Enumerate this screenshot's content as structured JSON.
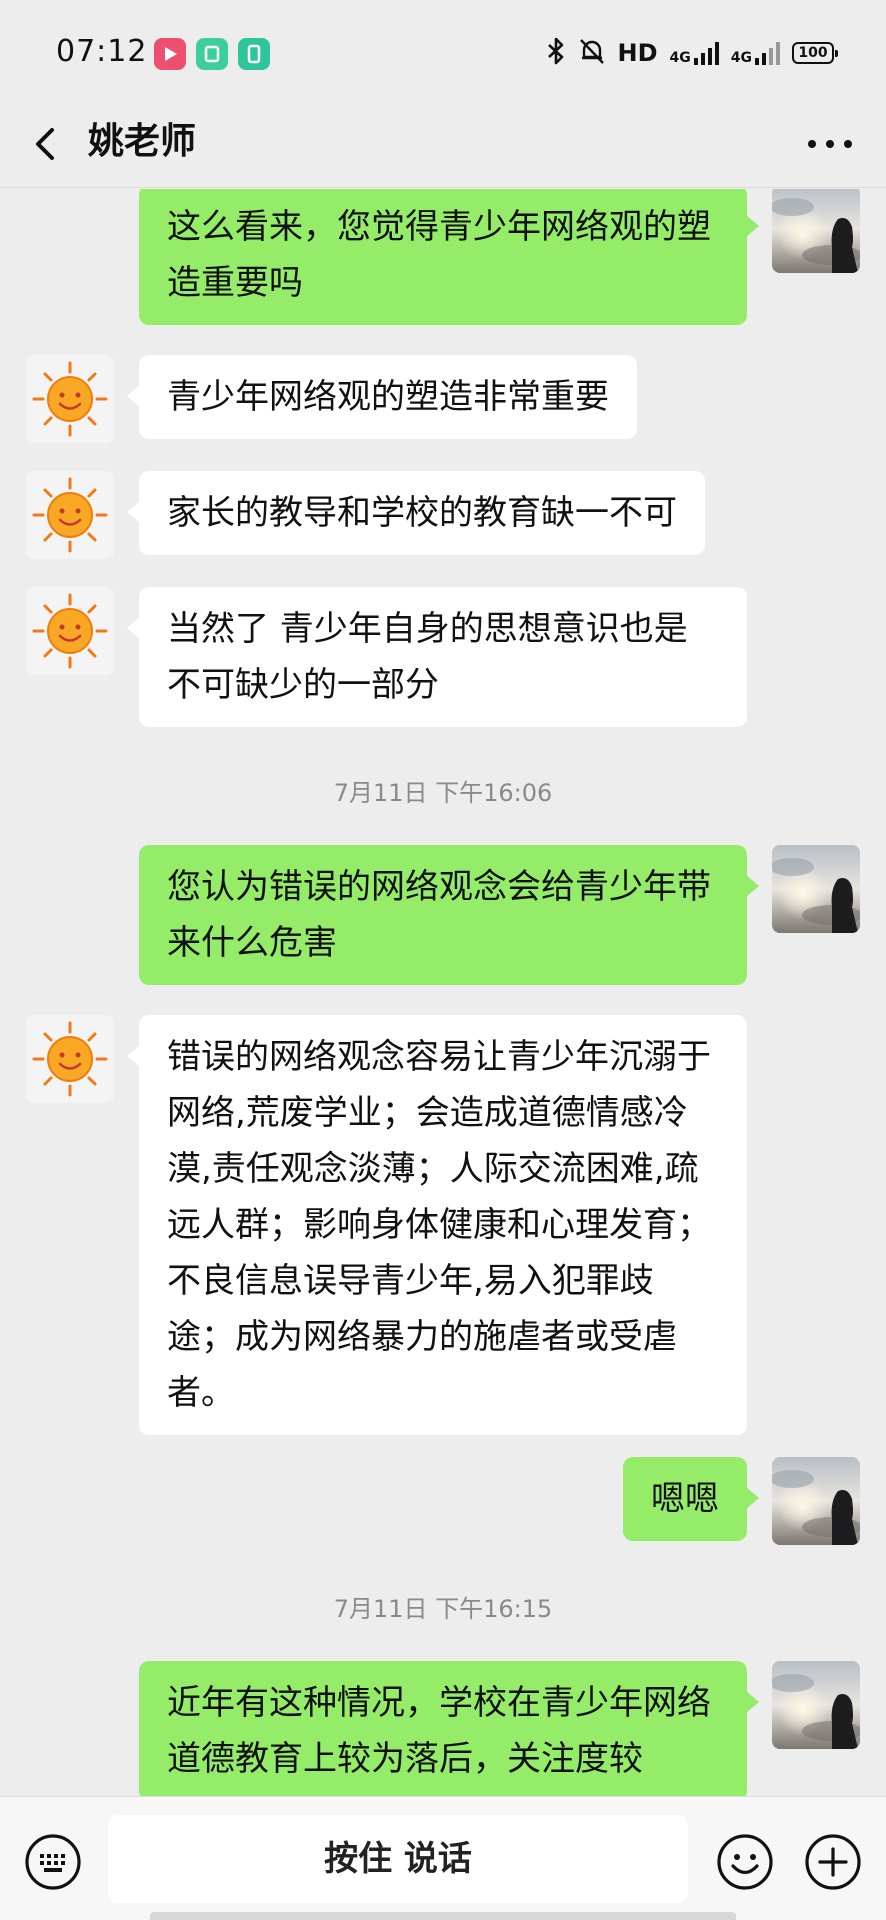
{
  "status": {
    "time": "07:12",
    "network_hd": "HD",
    "signal_1": "4G",
    "signal_2": "4G",
    "battery": "100",
    "app_icon_colors": [
      "#ef4f6f",
      "#3ccf9d",
      "#2fc59a"
    ]
  },
  "header": {
    "back_icon": "chevron-left-icon",
    "title": "姚老师",
    "more_icon": "more-dots-icon"
  },
  "messages": [
    {
      "side": "right",
      "text": "这么看来，您觉得青少年网络观的塑造重要吗"
    },
    {
      "side": "left",
      "text": "青少年网络观的塑造非常重要"
    },
    {
      "side": "left",
      "text": "家长的教导和学校的教育缺一不可"
    },
    {
      "side": "left",
      "text": "当然了 青少年自身的思想意识也是不可缺少的一部分"
    },
    {
      "timestamp": "7月11日 下午16:06"
    },
    {
      "side": "right",
      "text": "您认为错误的网络观念会给青少年带来什么危害"
    },
    {
      "side": "left",
      "text": "错误的网络观念容易让青少年沉溺于网络,荒废学业；会造成道德情感冷漠,责任观念淡薄；人际交流困难,疏远人群；影响身体健康和心理发育；不良信息误导青少年,易入犯罪歧途；成为网络暴力的施虐者或受虐者。"
    },
    {
      "side": "right",
      "text": "嗯嗯"
    },
    {
      "timestamp": "7月11日 下午16:15"
    },
    {
      "side": "right",
      "text": "近年有这种情况，学校在青少年网络道德教育上较为落后，关注度较"
    }
  ],
  "input_bar": {
    "keyboard_icon": "keyboard-icon",
    "hold_to_talk_label": "按住 说话",
    "emoji_icon": "emoji-icon",
    "plus_icon": "plus-icon"
  },
  "colors": {
    "background": "#ededed",
    "sent_bubble": "#95ec69",
    "received_bubble": "#ffffff"
  }
}
